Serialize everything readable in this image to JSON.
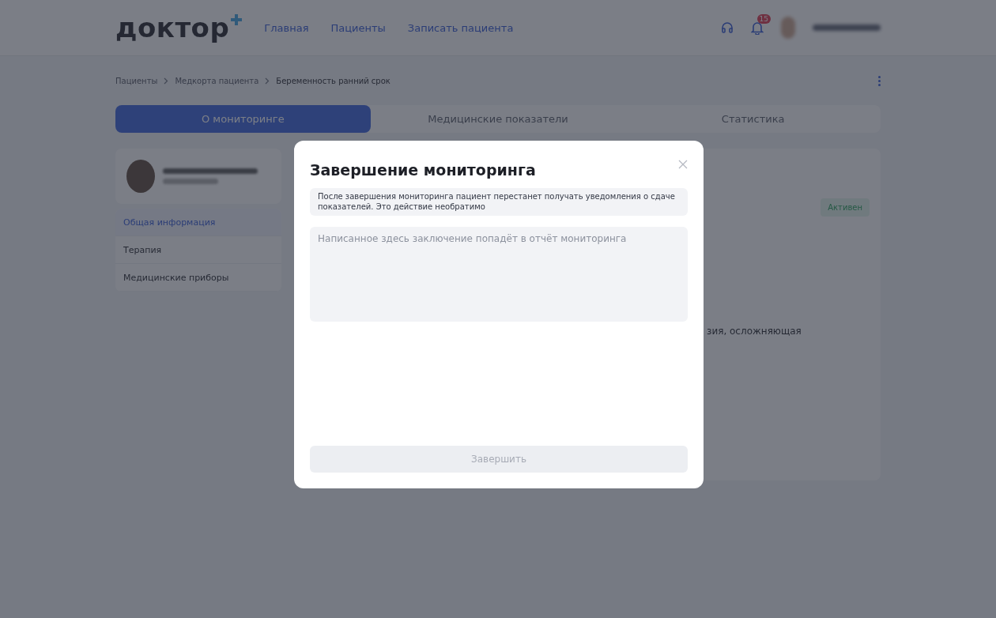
{
  "header": {
    "logo": "доктор",
    "nav": [
      {
        "label": "Главная"
      },
      {
        "label": "Пациенты"
      },
      {
        "label": "Записать пациента"
      }
    ],
    "notifications": {
      "count": "15"
    }
  },
  "breadcrumbs": [
    {
      "label": "Пациенты",
      "current": false
    },
    {
      "label": "Медкорта пациента",
      "current": false
    },
    {
      "label": "Беременность ранний срок",
      "current": true
    }
  ],
  "tabs": [
    {
      "label": "О мониторинге",
      "selected": true
    },
    {
      "label": "Медицинские показатели",
      "selected": false
    },
    {
      "label": "Статистика",
      "selected": false
    }
  ],
  "sidebar": {
    "items": [
      {
        "label": "Общая информация",
        "selected": true
      },
      {
        "label": "Терапия",
        "selected": false
      },
      {
        "label": "Медицинские приборы",
        "selected": false
      }
    ]
  },
  "content": {
    "status": "Активен",
    "text_fragment": "зия, осложняющая"
  },
  "modal": {
    "title": "Завершение мониторинга",
    "notice": "После завершения мониторинга пациент перестанет получать уведомления о сдаче показателей. Это действие необратимо",
    "conclusion": {
      "placeholder": "Написанное здесь заключение попадёт в отчёт мониторинга"
    },
    "submit": {
      "label": "Завершить",
      "disabled": true
    }
  }
}
